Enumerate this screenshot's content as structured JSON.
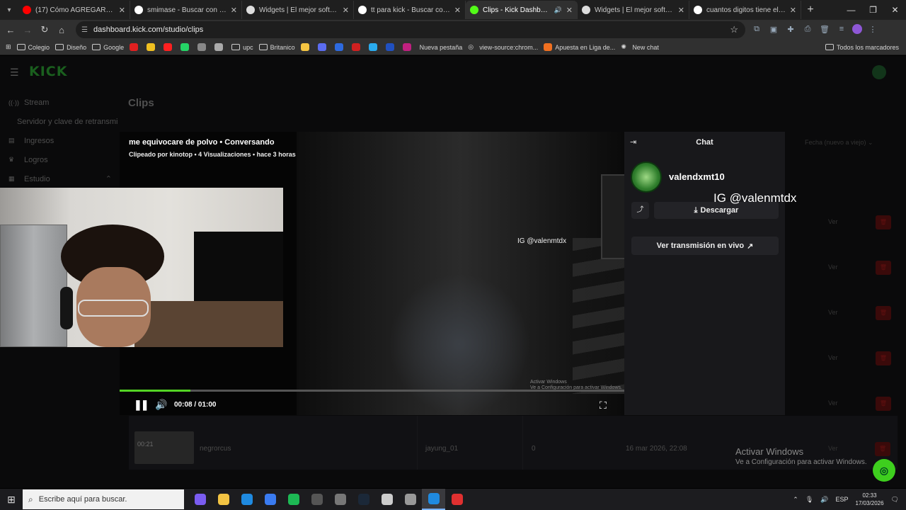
{
  "browser": {
    "tabs": [
      {
        "title": "(17) Cómo AGREGAR el CHAT d",
        "color": "#ff0000",
        "active": false
      },
      {
        "title": "smimase - Buscar con Google",
        "color": "#ffffff",
        "active": false
      },
      {
        "title": "Widgets | El mejor software pa",
        "color": "#dddddd",
        "active": false
      },
      {
        "title": "tt para kick - Buscar con Googl",
        "color": "#ffffff",
        "active": false
      },
      {
        "title": "Clips - Kick Dashboard",
        "color": "#53fc18",
        "active": true
      },
      {
        "title": "Widgets | El mejor software pa",
        "color": "#dddddd",
        "active": false
      },
      {
        "title": "cuantos digitos tiene el cci - Bu",
        "color": "#ffffff",
        "active": false
      }
    ],
    "url": "dashboard.kick.com/studio/clips",
    "bookmarks": [
      {
        "label": "Colegio",
        "icon": "folder-icon",
        "color": ""
      },
      {
        "label": "Diseño",
        "icon": "folder-icon",
        "color": ""
      },
      {
        "label": "Google",
        "icon": "folder-icon",
        "color": ""
      },
      {
        "label": "",
        "icon": "bookmark-icon",
        "color": "#e02020"
      },
      {
        "label": "",
        "icon": "bookmark-icon",
        "color": "#f0c020"
      },
      {
        "label": "",
        "icon": "bookmark-icon",
        "color": "#ff2020"
      },
      {
        "label": "",
        "icon": "bookmark-icon",
        "color": "#25d366"
      },
      {
        "label": "",
        "icon": "bookmark-icon",
        "color": "#888888"
      },
      {
        "label": "",
        "icon": "bookmark-icon",
        "color": "#aaaaaa"
      },
      {
        "label": "upc",
        "icon": "folder-icon",
        "color": ""
      },
      {
        "label": "Britanico",
        "icon": "folder-icon",
        "color": ""
      },
      {
        "label": "",
        "icon": "bookmark-icon",
        "color": "#f5c542"
      },
      {
        "label": "",
        "icon": "bookmark-icon",
        "color": "#5b6cf0"
      },
      {
        "label": "",
        "icon": "bookmark-icon",
        "color": "#2d6ae0"
      },
      {
        "label": "",
        "icon": "bookmark-icon",
        "color": "#d02020"
      },
      {
        "label": "",
        "icon": "bookmark-icon",
        "color": "#2aabee"
      },
      {
        "label": "",
        "icon": "bookmark-icon",
        "color": "#2050c0"
      },
      {
        "label": "",
        "icon": "bookmark-icon",
        "color": "#c02080"
      },
      {
        "label": "Nueva pestaña",
        "icon": "none",
        "color": ""
      },
      {
        "label": "view-source:chrom...",
        "icon": "globe-icon",
        "color": ""
      },
      {
        "label": "Apuesta en Liga de...",
        "icon": "bookmark-icon",
        "color": "#f07020"
      },
      {
        "label": "New chat",
        "icon": "openai-icon",
        "color": ""
      }
    ],
    "bookmarks_right": "Todos los marcadores"
  },
  "sidebar": {
    "items": [
      {
        "label": "Stream",
        "icon": "broadcast-icon",
        "sub": false
      },
      {
        "label": "Servidor y clave de retransmi",
        "icon": "",
        "sub": true
      },
      {
        "label": "Ingresos",
        "icon": "money-icon",
        "sub": false
      },
      {
        "label": "Logros",
        "icon": "trophy-icon",
        "sub": false
      },
      {
        "label": "Estudio",
        "icon": "studio-icon",
        "sub": false
      }
    ]
  },
  "page": {
    "title": "Clips",
    "sort_label": "Fecha (nuevo a viejo)"
  },
  "rows": {
    "ver_label": "Ver",
    "count": 5
  },
  "last_row": {
    "duration": "00:21",
    "title": "negrorcus",
    "creator": "jayung_01",
    "views": "0",
    "date": "16 mar 2026, 22:08"
  },
  "video": {
    "title": "me equivocare de polvo • Conversando",
    "subtitle": "Clipeado por kinotop • 4 Visualizaciones • hace 3 horas",
    "overlay_tag": "IG @valenmtdx",
    "time": "00:08 / 01:00",
    "progress": 0.14,
    "activate_small_1": "Activar Windows",
    "activate_small_2": "Ve a Configuración para activar Windows."
  },
  "chat": {
    "header": "Chat",
    "username": "valendxmt10",
    "download_label": "Descargar",
    "live_label": "Ver transmisión en vivo"
  },
  "overlay": {
    "ig_tag": "IG @valenmtdx"
  },
  "watermark": {
    "line1": "Activar Windows",
    "line2": "Ve a Configuración para activar Windows."
  },
  "taskbar": {
    "search_placeholder": "Escribe aquí para buscar.",
    "apps": [
      {
        "name": "copilot-icon",
        "color": "#7a5cf0"
      },
      {
        "name": "explorer-icon",
        "color": "#f2c343"
      },
      {
        "name": "chrome-icon",
        "color": "#1f8ae0"
      },
      {
        "name": "store-icon",
        "color": "#3a7bf0"
      },
      {
        "name": "spotify-icon",
        "color": "#1db954"
      },
      {
        "name": "app-icon",
        "color": "#555555"
      },
      {
        "name": "app-icon-2",
        "color": "#777777"
      },
      {
        "name": "steam-icon",
        "color": "#1b2838"
      },
      {
        "name": "settings-icon",
        "color": "#cccccc"
      },
      {
        "name": "files-icon",
        "color": "#999999"
      },
      {
        "name": "chrome-profile-icon",
        "color": "#1f8ae0"
      },
      {
        "name": "streamlabs-icon",
        "color": "#e03030"
      }
    ],
    "lang": "ESP",
    "time": "02:33",
    "date": "17/03/2026"
  }
}
